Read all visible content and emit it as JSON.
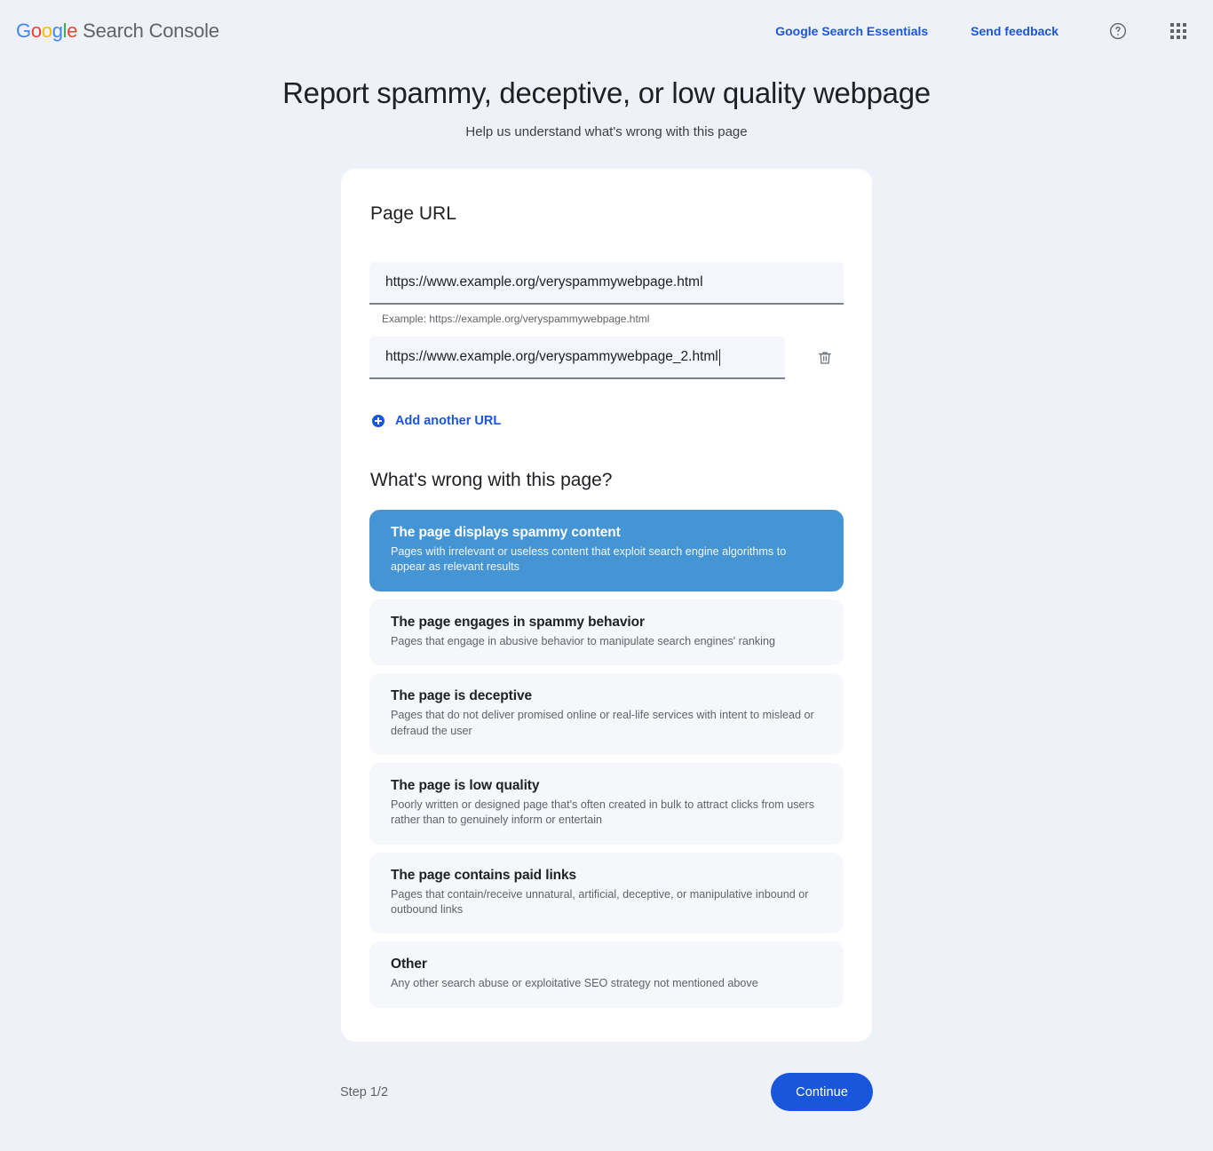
{
  "header": {
    "brand_google": "Google",
    "brand_product": "Search Console",
    "links": [
      {
        "label": "Google Search Essentials",
        "name": "google-search-essentials-link"
      },
      {
        "label": "Send feedback",
        "name": "send-feedback-link"
      }
    ],
    "help_icon": "help-circle-icon",
    "apps_icon": "apps-grid-icon",
    "link_color": "#1a56db"
  },
  "page": {
    "title": "Report spammy, deceptive, or low quality webpage",
    "subtitle": "Help us understand what's wrong with this page"
  },
  "form": {
    "url_section_title": "Page URL",
    "url_fields": [
      {
        "value": "https://www.example.org/veryspammywebpage.html",
        "placeholder": "https://example.org/veryspammywebpage.html",
        "hint": "Example: https://example.org/veryspammywebpage.html",
        "deletable": false
      },
      {
        "value": "https://www.example.org/veryspammywebpage_2.html",
        "placeholder": "https://example.org/veryspammywebpage.html",
        "hint": "",
        "deletable": true,
        "delete_icon": "trash-icon"
      }
    ],
    "add_url_label": "Add another URL",
    "add_url_icon": "plus-circle-icon",
    "question_title": "What's wrong with this page?",
    "selected_option_index": 0,
    "selected_color": "#4595d4",
    "options": [
      {
        "title": "The page displays spammy content",
        "desc": "Pages with irrelevant or useless content that exploit search engine algorithms to appear as relevant results"
      },
      {
        "title": "The page engages in spammy behavior",
        "desc": "Pages that engage in abusive behavior to manipulate search engines' ranking"
      },
      {
        "title": "The page is deceptive",
        "desc": "Pages that do not deliver promised online or real-life services with intent to mislead or defraud the user"
      },
      {
        "title": "The page is low quality",
        "desc": "Poorly written or designed page that's often created in bulk to attract clicks from users rather than to genuinely inform or entertain"
      },
      {
        "title": "The page contains paid links",
        "desc": "Pages that contain/receive unnatural, artificial, deceptive, or manipulative inbound or outbound links"
      },
      {
        "title": "Other",
        "desc": "Any other search abuse or exploitative SEO strategy not mentioned above"
      }
    ]
  },
  "footer": {
    "step_label": "Step 1/2",
    "continue_label": "Continue",
    "continue_color": "#1a56db"
  }
}
